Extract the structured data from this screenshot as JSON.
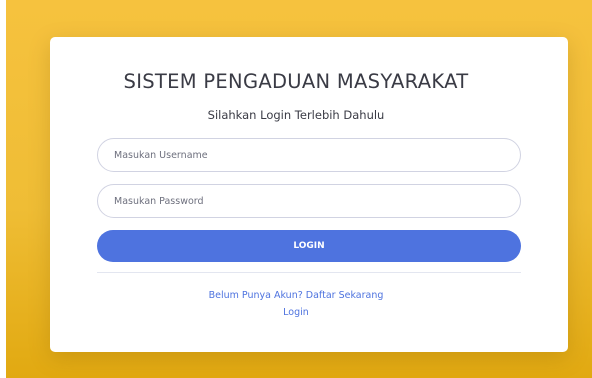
{
  "login_card": {
    "title": "SISTEM PENGADUAN MASYARAKAT",
    "subtitle": "Silahkan Login Terlebih Dahulu",
    "username_placeholder": "Masukan Username",
    "username_value": "",
    "password_placeholder": "Masukan Password",
    "password_value": "",
    "login_button_label": "LOGIN",
    "register_link": "Belum Punya Akun? Daftar Sekarang",
    "login_link": "Login"
  },
  "colors": {
    "background": "#f6c23e",
    "primary": "#4e73df",
    "card": "#ffffff",
    "text": "#3a3b45"
  }
}
